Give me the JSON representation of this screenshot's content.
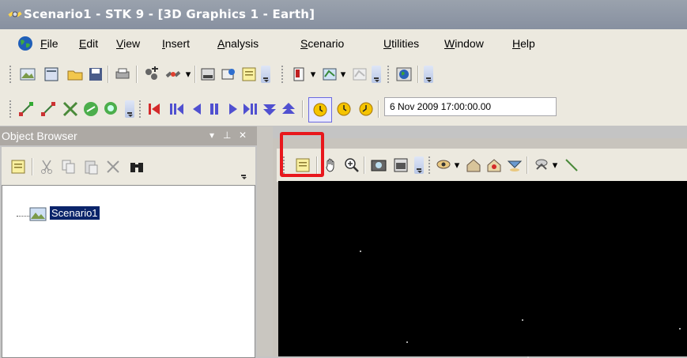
{
  "window": {
    "title": "Scenario1 - STK 9 - [3D Graphics 1 - Earth]",
    "icon": "satellite-icon"
  },
  "menu": {
    "items": [
      {
        "label": "File",
        "underline": "F",
        "rest": "ile"
      },
      {
        "label": "Edit",
        "underline": "E",
        "rest": "dit"
      },
      {
        "label": "View",
        "underline": "V",
        "rest": "iew"
      },
      {
        "label": "Insert",
        "underline": "I",
        "rest": "nsert"
      },
      {
        "label": "Analysis",
        "underline": "A",
        "rest": "nalysis"
      },
      {
        "label": "Scenario",
        "underline": "S",
        "rest": "cenario"
      },
      {
        "label": "Utilities",
        "underline": "U",
        "rest": "tilities"
      },
      {
        "label": "Window",
        "underline": "W",
        "rest": "indow"
      },
      {
        "label": "Help",
        "underline": "H",
        "rest": "elp"
      }
    ]
  },
  "animation": {
    "current_time": "6 Nov 2009 17:00:00.00"
  },
  "object_browser": {
    "title": "Object Browser",
    "pin": "▾ ⨪ ×",
    "tree": [
      {
        "label": "Scenario1",
        "icon": "scenario-icon",
        "selected": true
      }
    ]
  },
  "colors": {
    "highlight_box": "#e8171c",
    "selection": "#0a246a",
    "viewport_bg": "#000000"
  }
}
